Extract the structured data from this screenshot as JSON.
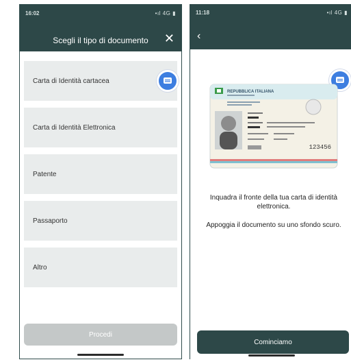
{
  "left_screen": {
    "status_time": "16:02",
    "status_indicators": "•ıl 4G ▮",
    "title": "Scegli il tipo di documento",
    "close_icon": "✕",
    "documents": [
      {
        "label": "Carta di Identità cartacea"
      },
      {
        "label": "Carta di Identità Elettronica"
      },
      {
        "label": "Patente"
      },
      {
        "label": "Passaporto"
      },
      {
        "label": "Altro"
      }
    ],
    "proceed_label": "Procedi"
  },
  "right_screen": {
    "status_time": "11:18",
    "status_indicators": "•ıl 4G ▮",
    "back_icon": "‹",
    "card": {
      "header": "REPUBBLICA ITALIANA",
      "number": "123456"
    },
    "instruction_1": "Inquadra il fronte della tua carta di identità elettronica.",
    "instruction_2": "Appoggia il documento su uno sfondo scuro.",
    "start_label": "Cominciamo"
  },
  "colors": {
    "header": "#2d4848",
    "list_item_bg": "#e9ecec",
    "disabled_button": "#c4c8c8",
    "chat_bubble": "#3d7ee0"
  },
  "icons": [
    "close-icon",
    "back-icon",
    "chat-icon"
  ]
}
